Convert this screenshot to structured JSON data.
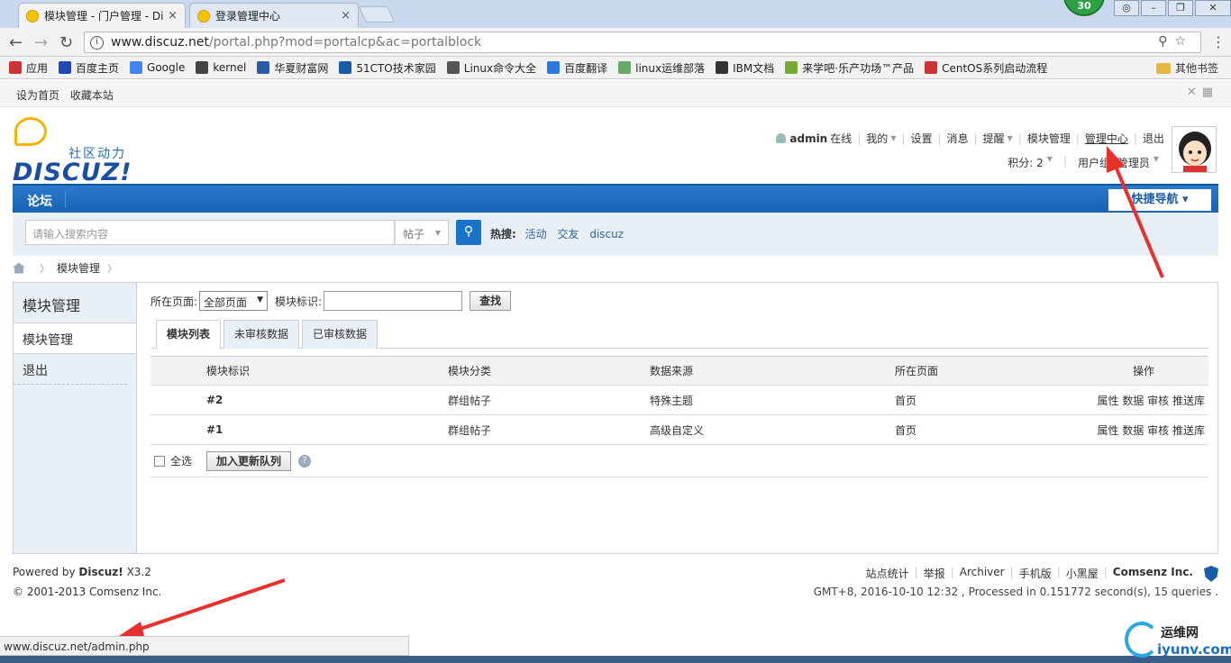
{
  "browser": {
    "tabs": [
      {
        "title": "模块管理 - 门户管理 - Di",
        "close": "×"
      },
      {
        "title": "登录管理中心",
        "close": "×"
      }
    ],
    "badge": "30",
    "url_host": "www.discuz.net",
    "url_path": "/portal.php?mod=portalcp&ac=portalblock",
    "bookmarks": [
      {
        "label": "应用",
        "color": "#c33"
      },
      {
        "label": "百度主页",
        "color": "#2347b5"
      },
      {
        "label": "Google",
        "color": "#4285f4"
      },
      {
        "label": "kernel",
        "color": "#444"
      },
      {
        "label": "华夏财富网",
        "color": "#2a5aa8"
      },
      {
        "label": "51CTO技术家园",
        "color": "#1a5ca8"
      },
      {
        "label": "Linux命令大全",
        "color": "#555"
      },
      {
        "label": "百度翻译",
        "color": "#2a7ae0"
      },
      {
        "label": "linux运维部落",
        "color": "#6a6"
      },
      {
        "label": "IBM文档",
        "color": "#333"
      },
      {
        "label": "来学吧·乐产功场™产品",
        "color": "#7a3"
      },
      {
        "label": "CentOS系列启动流程",
        "color": "#c33"
      }
    ],
    "other_bookmarks": "其他书签",
    "status_url": "www.discuz.net/admin.php"
  },
  "topbar": {
    "set_home": "设为首页",
    "bookmark": "收藏本站"
  },
  "logo": {
    "cn": "社区动力",
    "en": "DISCUZ!"
  },
  "user": {
    "name": "admin",
    "online": "在线",
    "links": [
      "我的",
      "设置",
      "消息",
      "提醒",
      "模块管理",
      "管理中心",
      "退出"
    ],
    "points": "积分: 2",
    "group": "用户组: 管理员"
  },
  "nav": {
    "forum": "论坛",
    "quick_nav": "快捷导航"
  },
  "search": {
    "placeholder": "请输入搜索内容",
    "type": "帖子",
    "hot_label": "热搜:",
    "hot": [
      "活动",
      "交友",
      "discuz"
    ]
  },
  "breadcrumb": {
    "current": "模块管理"
  },
  "sidebar": {
    "title": "模块管理",
    "items": [
      "模块管理",
      "退出"
    ]
  },
  "filter": {
    "page_label": "所在页面:",
    "page_value": "全部页面",
    "id_label": "模块标识:",
    "search_btn": "查找"
  },
  "tabs": [
    "模块列表",
    "未审核数据",
    "已审核数据"
  ],
  "table": {
    "headers": [
      "模块标识",
      "模块分类",
      "数据来源",
      "所在页面",
      "操作"
    ],
    "rows": [
      {
        "id": "#2",
        "category": "群组帖子",
        "source": "特殊主题",
        "page": "首页",
        "ops": "属性 数据 审核 推送库"
      },
      {
        "id": "#1",
        "category": "群组帖子",
        "source": "高级自定义",
        "page": "首页",
        "ops": "属性 数据 审核 推送库"
      }
    ],
    "select_all": "全选",
    "queue_btn": "加入更新队列"
  },
  "footer": {
    "powered": "Powered by",
    "product": "Discuz!",
    "version": "X3.2",
    "copyright": "© 2001-2013 Comsenz Inc.",
    "links": [
      "站点统计",
      "举报",
      "Archiver",
      "手机版",
      "小黑屋"
    ],
    "company": "Comsenz Inc.",
    "status": "GMT+8, 2016-10-10 12:32 , Processed in 0.151772 second(s), 15 queries ."
  },
  "watermark": {
    "cn": "运维网",
    "en": "iyunv.com"
  },
  "colors": {
    "nav": "#1662b5",
    "link": "#336699",
    "arrow": "#e8302c"
  }
}
